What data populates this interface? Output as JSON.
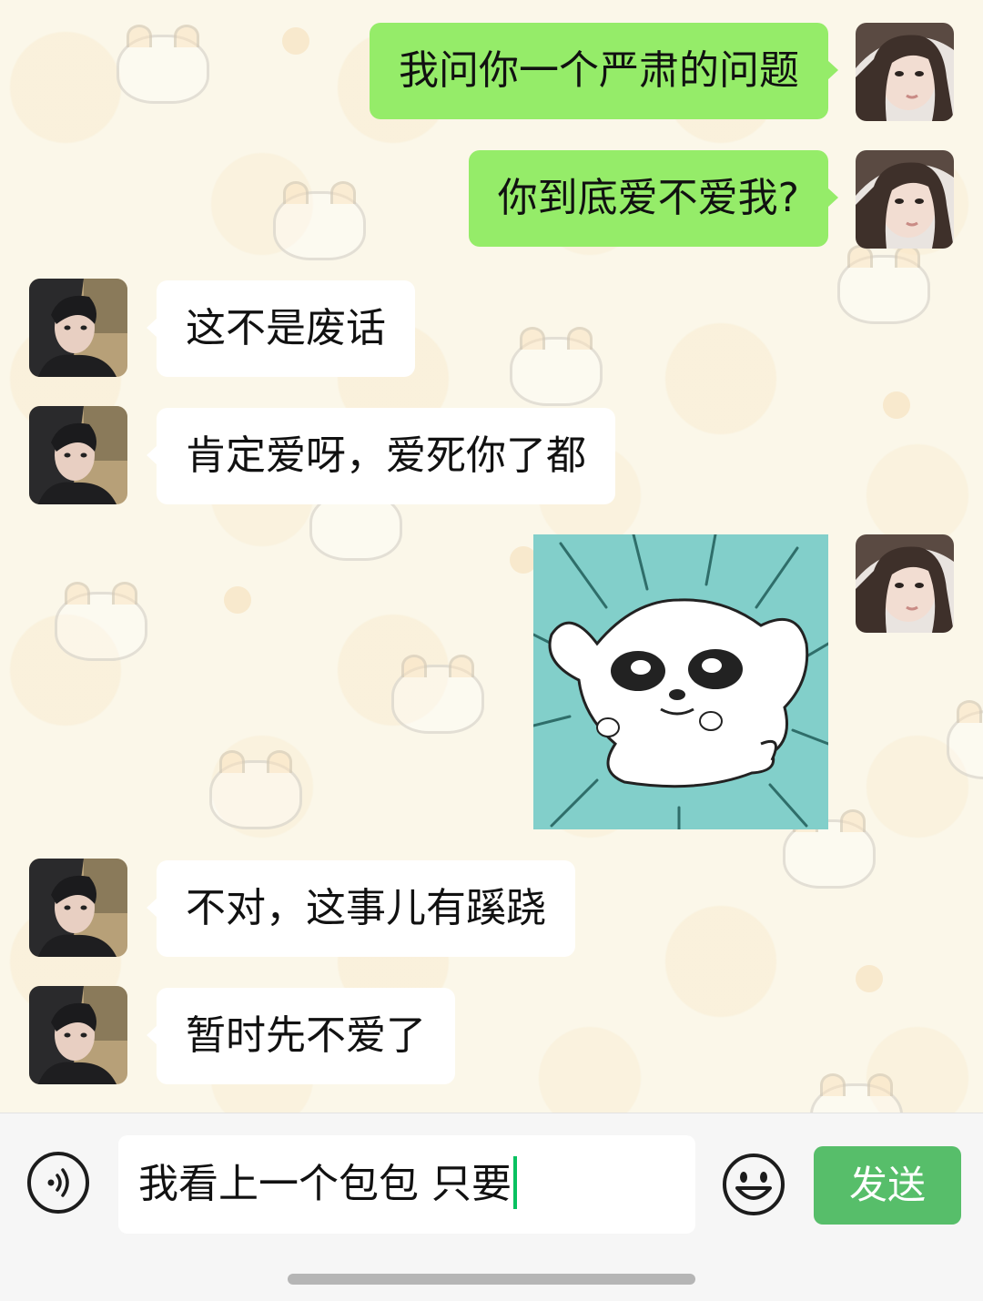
{
  "messages": [
    {
      "id": "m1",
      "side": "out",
      "type": "text",
      "text": "我问你一个严肃的问题"
    },
    {
      "id": "m2",
      "side": "out",
      "type": "text",
      "text": "你到底爱不爱我?"
    },
    {
      "id": "m3",
      "side": "in",
      "type": "text",
      "text": "这不是废话"
    },
    {
      "id": "m4",
      "side": "in",
      "type": "text",
      "text": "肯定爱呀，爱死你了都"
    },
    {
      "id": "m5",
      "side": "out",
      "type": "sticker",
      "sticker": "shocked-white-puppy"
    },
    {
      "id": "m6",
      "side": "in",
      "type": "text",
      "text": "不对，这事儿有蹊跷"
    },
    {
      "id": "m7",
      "side": "in",
      "type": "text",
      "text": "暂时先不爱了"
    }
  ],
  "composer": {
    "draft_text": "我看上一个包包 只要",
    "send_label": "发送",
    "voice_icon": "voice-icon",
    "emoji_icon": "emoji-icon"
  },
  "colors": {
    "outgoing_bubble": "#95ec69",
    "incoming_bubble": "#ffffff",
    "send_button": "#57be6a",
    "sticker_bg": "#82cfca",
    "caret": "#07c160"
  }
}
